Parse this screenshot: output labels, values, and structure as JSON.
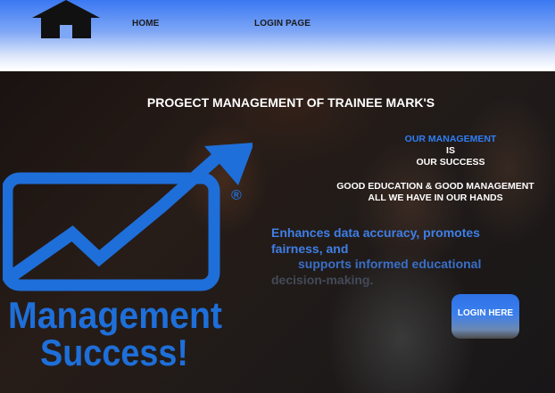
{
  "nav": {
    "home_label": "HOME",
    "login_label": "LOGIN PAGE"
  },
  "hero": {
    "title": "PROGECT MANAGEMENT OF TRAINEE MARK'S",
    "motto": {
      "line1": "OUR MANAGEMENT",
      "line2": "IS",
      "line3": "OUR SUCCESS"
    },
    "slogan": {
      "line1": "GOOD EDUCATION  & GOOD MANAGEMENT",
      "line2": "ALL WE HAVE IN OUR HANDS"
    },
    "description": {
      "line1": "Enhances data accuracy, promotes",
      "line2": "fairness, and",
      "line3": "supports informed educational",
      "line4": "decision-making."
    },
    "login_button_label": "LOGIN HERE"
  },
  "logo": {
    "line1": "Management",
    "line2": "Success!",
    "registered_mark": "®"
  },
  "colors": {
    "accent_blue": "#1e6fd9",
    "nav_gradient_top": "#3a78f2",
    "text_white": "#ffffff"
  },
  "icons": {
    "home": "home-icon"
  }
}
